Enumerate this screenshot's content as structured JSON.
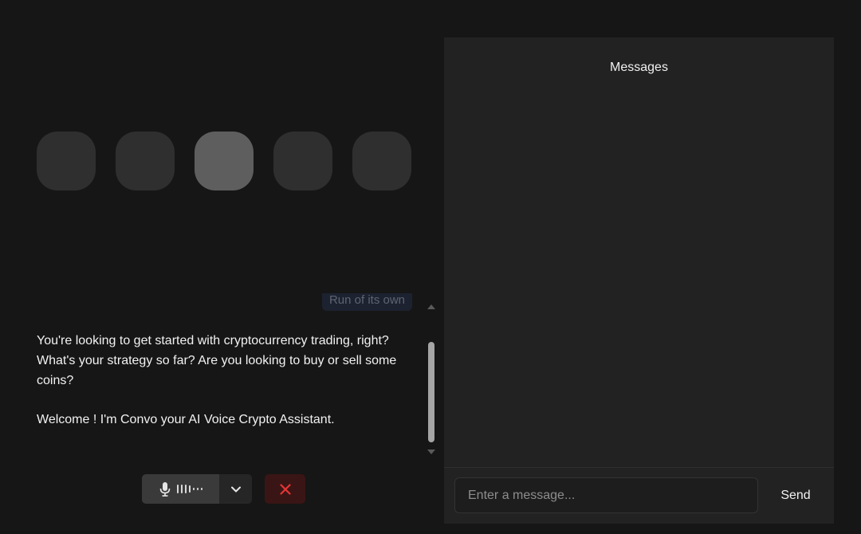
{
  "agent": {
    "visualizer_bars": [
      {
        "state": "idle"
      },
      {
        "state": "idle"
      },
      {
        "state": "active"
      },
      {
        "state": "idle"
      },
      {
        "state": "idle"
      }
    ]
  },
  "transcript": {
    "user_message": "Run of its own",
    "assistant_messages": [
      "You're looking to get started with cryptocurrency trading, right? What's your strategy so far? Are you looking to buy or sell some coins?",
      "Welcome ! I'm Convo your AI Voice Crypto Assistant."
    ]
  },
  "controls": {
    "microphone_icon": "microphone-icon",
    "chevron_icon": "chevron-down-icon",
    "disconnect_icon": "close-icon",
    "disconnect_color": "#e53535"
  },
  "chat": {
    "title": "Messages",
    "input_placeholder": "Enter a message...",
    "send_label": "Send"
  }
}
